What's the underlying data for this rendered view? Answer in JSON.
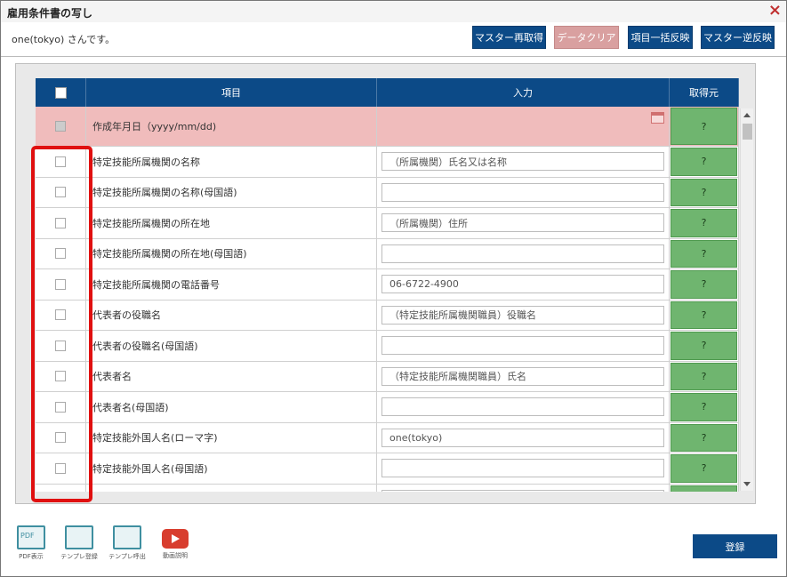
{
  "window": {
    "title": "雇用条件書の写し",
    "close_icon": "×"
  },
  "user_line": "one(tokyo) さんです。",
  "toolbar": {
    "master_refetch": "マスター再取得",
    "data_clear": "データクリア",
    "batch_apply": "項目一括反映",
    "master_reverse": "マスター逆反映"
  },
  "table": {
    "headers": {
      "item": "項目",
      "input": "入力",
      "source": "取得元"
    },
    "rows": [
      {
        "label": "作成年月日（yyyy/mm/dd)",
        "value": "",
        "source": "?"
      },
      {
        "label": "特定技能所属機関の名称",
        "value": "（所属機関）氏名又は名称",
        "source": "?"
      },
      {
        "label": "特定技能所属機関の名称(母国語)",
        "value": "",
        "source": "?"
      },
      {
        "label": "特定技能所属機関の所在地",
        "value": "（所属機関）住所",
        "source": "?"
      },
      {
        "label": "特定技能所属機関の所在地(母国語)",
        "value": "",
        "source": "?"
      },
      {
        "label": "特定技能所属機関の電話番号",
        "value": "06-6722-4900",
        "source": "?"
      },
      {
        "label": "代表者の役職名",
        "value": "（特定技能所属機関職員）役職名",
        "source": "?"
      },
      {
        "label": "代表者の役職名(母国語)",
        "value": "",
        "source": "?"
      },
      {
        "label": "代表者名",
        "value": "（特定技能所属機関職員）氏名",
        "source": "?"
      },
      {
        "label": "代表者名(母国語)",
        "value": "",
        "source": "?"
      },
      {
        "label": "特定技能外国人名(ローマ字)",
        "value": "one(tokyo)",
        "source": "?"
      },
      {
        "label": "特定技能外国人名(母国語)",
        "value": "",
        "source": "?"
      },
      {
        "label": "",
        "value": "",
        "source": "?"
      }
    ]
  },
  "bottom": {
    "pdf_box": "PDF",
    "pdf_label": "PDF表示",
    "template_save_label": "テンプレ登録",
    "template_load_label": "テンプレ呼出",
    "video_label": "動画説明",
    "register": "登録"
  },
  "colors": {
    "header_blue": "#0c4a87",
    "highlight_row": "#f0bcbc",
    "source_green": "#6fb56f",
    "annotation_red": "#e01010"
  }
}
